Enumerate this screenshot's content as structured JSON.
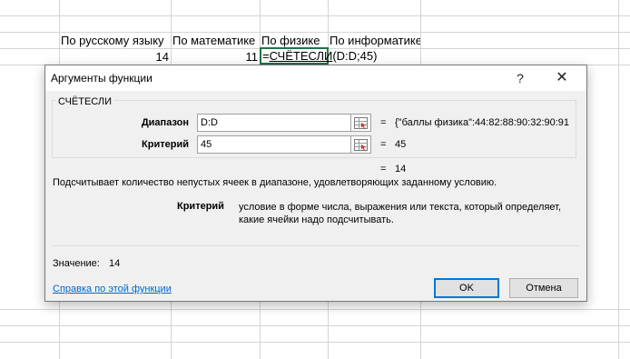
{
  "sheet": {
    "headers": [
      "По русскому языку",
      "По математике",
      "По физике",
      "По информатике"
    ],
    "row_values": [
      "14",
      "11"
    ],
    "formula_prefix": "=",
    "formula_fn": "СЧЁТЕСЛИ",
    "formula_args": "(D:D;45)"
  },
  "dialog": {
    "title": "Аргументы функции",
    "help_glyph": "?",
    "close_glyph": "✕",
    "function_name": "СЧЁТЕСЛИ",
    "args": [
      {
        "label": "Диапазон",
        "value": "D:D",
        "result": "{\"баллы физика\":44:82:88:90:32:90:91"
      },
      {
        "label": "Критерий",
        "value": "45",
        "result": "45"
      }
    ],
    "equals": "=",
    "formula_result": "14",
    "description": "Подсчитывает количество непустых ячеек в диапазоне, удовлетворяющих заданному условию.",
    "criterion_label": "Критерий",
    "criterion_desc": "условие в форме числа, выражения или текста, который определяет, какие ячейки надо подсчитывать.",
    "value_label": "Значение:",
    "value": "14",
    "help_link": "Справка по этой функции",
    "ok_label": "OK",
    "cancel_label": "Отмена"
  },
  "colors": {
    "active_cell_border": "#217346",
    "link": "#0066cc",
    "ok_border": "#0078d7"
  },
  "icons": [
    "range-selector-icon",
    "help-icon",
    "close-icon"
  ]
}
